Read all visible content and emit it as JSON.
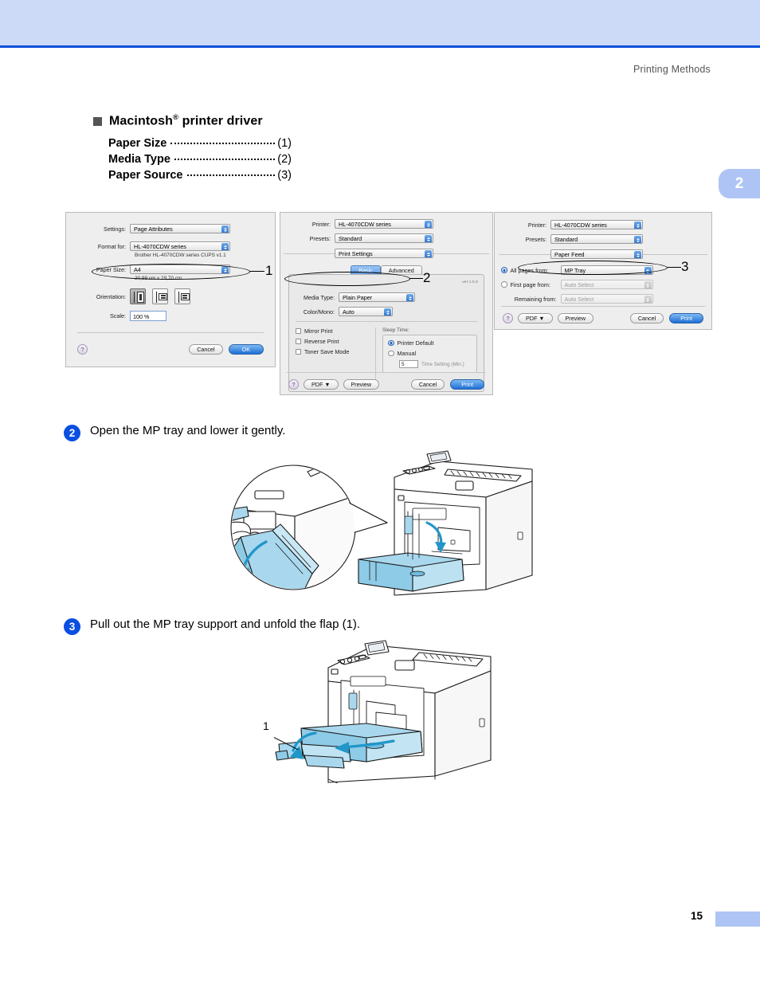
{
  "page": {
    "running_head": "Printing Methods",
    "chapter_tab": "2",
    "page_number": "15"
  },
  "section": {
    "heading_main": "Macintosh",
    "heading_sup": "®",
    "heading_rest": " printer driver",
    "items": [
      {
        "label": "Paper Size",
        "num": "(1)"
      },
      {
        "label": "Media Type",
        "num": "(2)"
      },
      {
        "label": "Paper Source",
        "num": "(3)"
      }
    ]
  },
  "dialog1": {
    "callout": "1",
    "settings_label": "Settings:",
    "settings_value": "Page Attributes",
    "format_label": "Format for:",
    "format_value": "HL-4070CDW series",
    "format_note": "Brother HL-4070CDW series CUPS v1.1",
    "paper_size_label": "Paper Size:",
    "paper_size_value": "A4",
    "paper_dims": "20,99 cm x 29,70 cm",
    "orientation_label": "Orientation:",
    "scale_label": "Scale:",
    "scale_value": "100 %",
    "help_label": "?",
    "cancel_label": "Cancel",
    "ok_label": "OK"
  },
  "dialog2": {
    "callout": "2",
    "printer_label": "Printer:",
    "printer_value": "HL-4070CDW series",
    "presets_label": "Presets:",
    "presets_value": "Standard",
    "pane_value": "Print Settings",
    "tab_basic": "Basic",
    "tab_advanced": "Advanced",
    "version": "ver:1.0.0",
    "media_type_label": "Media Type:",
    "media_type_value": "Plain Paper",
    "color_mono_label": "Color/Mono:",
    "color_mono_value": "Auto",
    "check_mirror": "Mirror Print",
    "check_reverse": "Reverse Print",
    "check_toner": "Toner Save Mode",
    "sleep_group": "Sleep Time:",
    "radio_default": "Printer Default",
    "radio_manual": "Manual",
    "time_value": "5",
    "time_caption": "Time Setting (Min.)",
    "help_label": "?",
    "pdf_label": "PDF ▼",
    "preview_label": "Preview",
    "cancel_label": "Cancel",
    "print_label": "Print"
  },
  "dialog3": {
    "callout": "3",
    "printer_label": "Printer:",
    "printer_value": "HL-4070CDW series",
    "presets_label": "Presets:",
    "presets_value": "Standard",
    "pane_value": "Paper Feed",
    "all_pages_label": "All pages from:",
    "all_pages_value": "MP Tray",
    "first_page_label": "First page from:",
    "first_page_value": "Auto Select",
    "remaining_label": "Remaining from:",
    "remaining_value": "Auto Select",
    "help_label": "?",
    "pdf_label": "PDF ▼",
    "preview_label": "Preview",
    "cancel_label": "Cancel",
    "print_label": "Print"
  },
  "steps": [
    {
      "num": "2",
      "text": "Open the MP tray and lower it gently."
    },
    {
      "num": "3",
      "text": "Pull out the MP tray support and unfold the flap (1)."
    }
  ],
  "illustration3": {
    "callout": "1"
  },
  "colors": {
    "banner": "#ccdaf8",
    "banner_rule": "#0a50dc",
    "step_badge": "#0b4fe0",
    "tab": "#aec4f4",
    "illustration_fill": "#aedcf0"
  }
}
